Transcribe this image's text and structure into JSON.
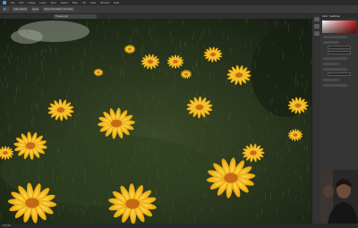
{
  "menubar": {
    "items": [
      "File",
      "Edit",
      "Image",
      "Layer",
      "Type",
      "Select",
      "Filter",
      "3D",
      "View",
      "Window",
      "Help"
    ]
  },
  "options": {
    "items": [
      "Auto-Select",
      "Layer",
      "Show Transform Controls"
    ]
  },
  "document": {
    "tab_label": "Flowers.psd"
  },
  "status": {
    "text": "33.33%"
  },
  "panel": {
    "tabs": [
      "Color",
      "Swatches"
    ]
  },
  "colors": {
    "accent": "#31a8ff",
    "app_bg": "#1e1e1e",
    "panel_bg": "#353535",
    "flower": "#f2b705",
    "flower_center": "#c46a14"
  }
}
